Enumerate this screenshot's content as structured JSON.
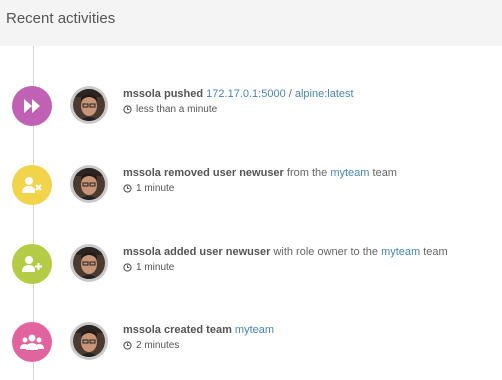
{
  "header": {
    "title": "Recent activities"
  },
  "activities": [
    {
      "actor": "mssola",
      "action": "pushed",
      "link1": "172.17.0.1:5000",
      "separator": " / ",
      "link2": "alpine:latest",
      "time": "less than a minute",
      "badge_color": "#c061b3",
      "icon": "fast-forward-icon"
    },
    {
      "actor": "mssola",
      "action": "removed user",
      "target": "newuser",
      "pre_link": "from the",
      "link": "myteam",
      "post_link": "team",
      "time": "1 minute",
      "badge_color": "#f2d44a",
      "icon": "remove-user-icon"
    },
    {
      "actor": "mssola",
      "action": "added user",
      "target": "newuser",
      "pre_link": "with role owner to the",
      "link": "myteam",
      "post_link": "team",
      "time": "1 minute",
      "badge_color": "#b4cc45",
      "icon": "add-user-icon"
    },
    {
      "actor": "mssola",
      "action": "created team",
      "link": "myteam",
      "time": "2 minutes",
      "badge_color": "#e2649e",
      "icon": "group-icon"
    }
  ]
}
